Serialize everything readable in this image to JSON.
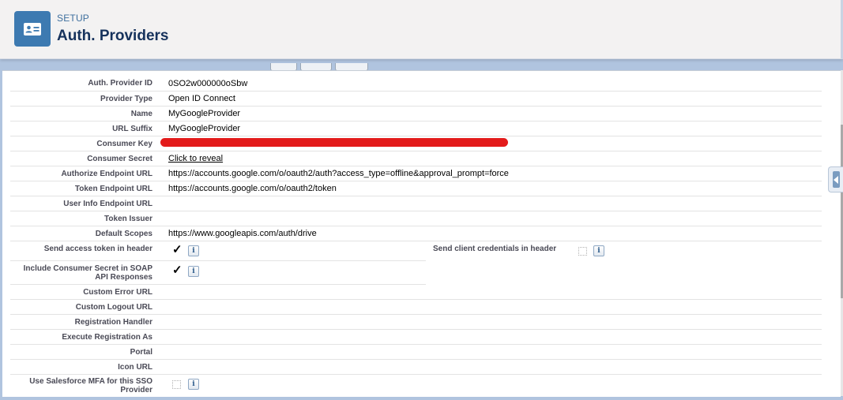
{
  "header": {
    "eyebrow": "SETUP",
    "title": "Auth. Providers",
    "icon": "contact-card-icon"
  },
  "fields": {
    "auth_provider_id": {
      "label": "Auth. Provider ID",
      "value": "0SO2w000000oSbw"
    },
    "provider_type": {
      "label": "Provider Type",
      "value": "Open ID Connect"
    },
    "name": {
      "label": "Name",
      "value": "MyGoogleProvider"
    },
    "url_suffix": {
      "label": "URL Suffix",
      "value": "MyGoogleProvider"
    },
    "consumer_key": {
      "label": "Consumer Key"
    },
    "consumer_secret": {
      "label": "Consumer Secret",
      "value": "Click to reveal"
    },
    "authorize_endpoint_url": {
      "label": "Authorize Endpoint URL",
      "value": "https://accounts.google.com/o/oauth2/auth?access_type=offline&approval_prompt=force"
    },
    "token_endpoint_url": {
      "label": "Token Endpoint URL",
      "value": "https://accounts.google.com/o/oauth2/token"
    },
    "user_info_endpoint_url": {
      "label": "User Info Endpoint URL",
      "value": ""
    },
    "token_issuer": {
      "label": "Token Issuer",
      "value": ""
    },
    "default_scopes": {
      "label": "Default Scopes",
      "value": "https://www.googleapis.com/auth/drive"
    },
    "send_access_token_in_header": {
      "label": "Send access token in header",
      "checked": true
    },
    "send_client_credentials_in_header": {
      "label": "Send client credentials in header",
      "checked": false
    },
    "include_consumer_secret": {
      "label": "Include Consumer Secret in SOAP API Responses",
      "checked": true
    },
    "custom_error_url": {
      "label": "Custom Error URL",
      "value": ""
    },
    "custom_logout_url": {
      "label": "Custom Logout URL",
      "value": ""
    },
    "registration_handler": {
      "label": "Registration Handler",
      "value": ""
    },
    "execute_registration_as": {
      "label": "Execute Registration As",
      "value": ""
    },
    "portal": {
      "label": "Portal",
      "value": ""
    },
    "icon_url": {
      "label": "Icon URL",
      "value": ""
    },
    "use_salesforce_mfa": {
      "label": "Use Salesforce MFA for this SSO Provider",
      "checked": false
    }
  },
  "info_glyph": "i",
  "check_glyph": "✓",
  "colors": {
    "app_icon": "#3d7ab1",
    "title": "#16325c",
    "redaction": "#e31b1b",
    "background": "#b0c4df"
  }
}
